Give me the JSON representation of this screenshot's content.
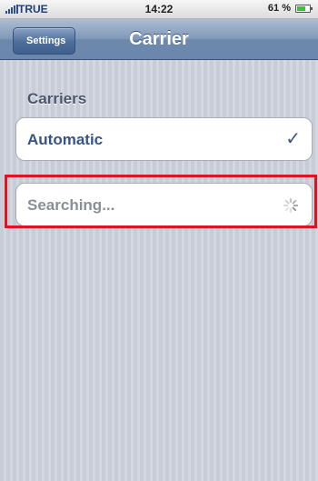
{
  "status_bar": {
    "carrier": "TRUE",
    "time": "14:22",
    "battery_percent": "61 %",
    "battery_level": 0.61
  },
  "nav": {
    "back_label": "Settings",
    "title": "Carrier"
  },
  "section": {
    "header": "Carriers"
  },
  "options": {
    "automatic": {
      "label": "Automatic",
      "checked_icon": "checkmark-icon",
      "checkmark": "✓"
    },
    "searching": {
      "label": "Searching...",
      "icon": "spinner-icon"
    }
  },
  "colors": {
    "highlight": "#e0141e",
    "cell_text_selected": "#385487",
    "nav_bar": "#6e88ab"
  }
}
